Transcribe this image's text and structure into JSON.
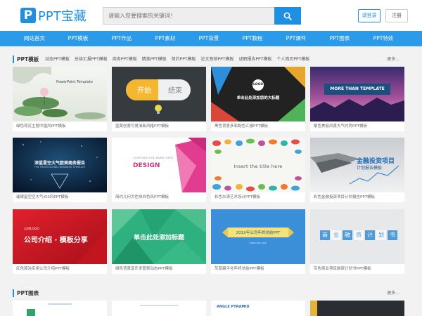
{
  "header": {
    "logo_mark": "P",
    "logo_text": "PPT宝藏",
    "search_placeholder": "请输入您要搜索的关键词！",
    "login_label": "请登录",
    "register_label": "注册",
    "brand_color": "#1e8fe1"
  },
  "nav": {
    "items": [
      "网站首页",
      "PPT模板",
      "PPT作品",
      "PPT素材",
      "PPT背景",
      "PPT教程",
      "PPT课件",
      "PPT图表",
      "PPT特效"
    ]
  },
  "section1": {
    "title": "PPT模板",
    "tags": [
      "动态PPT模板",
      "总结汇报PPT模板",
      "商务PPT模板",
      "精美PPT模板",
      "简约PPT模板",
      "论文答辩PPT模板",
      "述职报告PPT模板",
      "个人简历PPT模板"
    ],
    "more": "更多..."
  },
  "cards": [
    {
      "caption": "绿色荷花主题中国风PPT模板",
      "thumb_text": "PowerPoint Template"
    },
    {
      "caption": "蓝黄创意可爱清新风格PPT模板",
      "thumb_text_a": "开始",
      "thumb_text_b": "结束"
    },
    {
      "caption": "黑色背景多彩配色汇报PPT模板",
      "thumb_text_a": "LOGO",
      "thumb_text_b": "单击此处添加您的大标题"
    },
    {
      "caption": "紫色美丽风景大气时尚PPT模板",
      "thumb_text": "MORE THAN TEMPLATE"
    },
    {
      "caption": "璀璨星空空大气iOS风PPT模板",
      "thumb_text_a": "深蓝星空大气欧美商务报告",
      "thumb_text_b": "THE PROFESSIONAL BUSINESS TEMPLATE"
    },
    {
      "caption": "简约几何大色块白色风PPT模板",
      "thumb_text_a": "CORPORATION NAME HERE",
      "thumb_text_b": "DESIGN"
    },
    {
      "caption": "彩色水滴艺术设计PPT模板",
      "thumb_text": "Insert the title here"
    },
    {
      "caption": "彩色金融投资项目计划报告PPT模板",
      "thumb_text_a": "金融投资项目",
      "thumb_text_b": "计划报告模板"
    },
    {
      "caption": "红色简洁实用公司介绍PPT模板",
      "thumb_text_a": "公司LOGO",
      "thumb_text_b": "公司介绍 · 模板分享"
    },
    {
      "caption": "绿色背景音乐多图表动态PPT模板",
      "thumb_text": "单击此处添加标题"
    },
    {
      "caption": "灰蓝扁平化年终总结PPT模板",
      "thumb_text_a": "201X年公司年终总结PPT",
      "thumb_text_b": "www.xxx.com"
    },
    {
      "caption": "灰色商业项目融资计划书PPT模板",
      "thumb_text": [
        "商",
        "业",
        "融",
        "资",
        "计",
        "划",
        "书"
      ]
    }
  ],
  "section2": {
    "title": "PPT图表",
    "more": "更多...",
    "card_texts": [
      "",
      "",
      "ANGLE PYRAMID",
      ""
    ]
  }
}
